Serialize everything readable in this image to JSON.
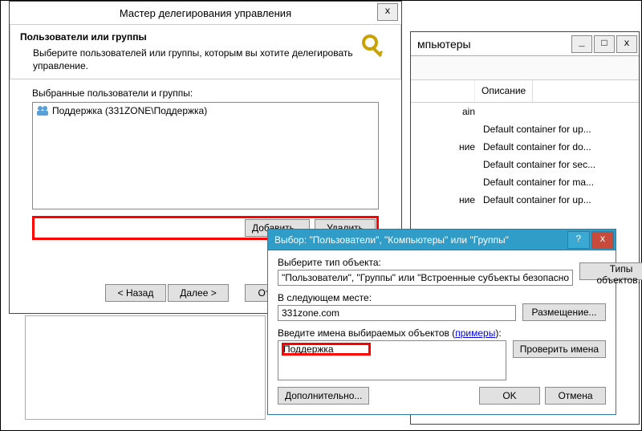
{
  "bgwin": {
    "title_suffix": "мпьютеры",
    "btn_min": "_",
    "btn_max": "□",
    "btn_close": "x",
    "col_desc": "Описание",
    "rows": [
      {
        "c1": "ain",
        "c2": ""
      },
      {
        "c1": "",
        "c2": "Default container for up..."
      },
      {
        "c1": "ние",
        "c2": "Default container for do..."
      },
      {
        "c1": "",
        "c2": "Default container for sec..."
      },
      {
        "c1": "",
        "c2": "Default container for ma..."
      },
      {
        "c1": "ние",
        "c2": "Default container for up..."
      }
    ]
  },
  "wizard": {
    "title": "Мастер делегирования управления",
    "close": "x",
    "heading": "Пользователи или группы",
    "sub": "Выберите пользователей или группы, которым вы хотите делегировать управление.",
    "list_label": "Выбранные пользователи и группы:",
    "list_item": "Поддержка (331ZONE\\Поддержка)",
    "btn_add": "Добавить...",
    "btn_remove": "Удалить",
    "btn_back": "< Назад",
    "btn_next": "Далее >",
    "btn_cancel": "Отмена"
  },
  "select": {
    "title": "Выбор: \"Пользователи\", \"Компьютеры\" или \"Группы\"",
    "btn_help": "?",
    "btn_close": "x",
    "obj_label": "Выберите тип объекта:",
    "obj_value": "\"Пользователи\", \"Группы\" или \"Встроенные субъекты безопасно",
    "btn_objtypes": "Типы объектов...",
    "loc_label": "В следующем месте:",
    "loc_value": "331zone.com",
    "btn_locations": "Размещение...",
    "names_label_pre": "Введите имена выбираемых объектов (",
    "names_label_link": "примеры",
    "names_label_post": "):",
    "names_value": "Поддержка",
    "btn_check": "Проверить имена",
    "btn_adv": "Дополнительно...",
    "btn_ok": "OK",
    "btn_cancel": "Отмена"
  }
}
